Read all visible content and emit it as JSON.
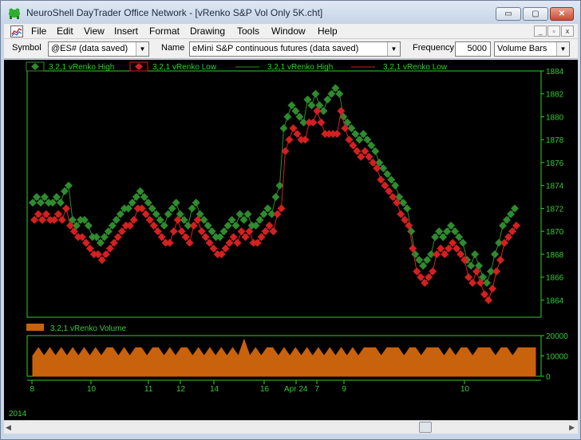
{
  "window": {
    "title": "NeuroShell DayTrader Office Network - [vRenko S&P Vol Only 5K.cht]",
    "controls": {
      "minimize": "▭",
      "maximize": "▢",
      "close": "✕"
    }
  },
  "menubar": {
    "items": [
      "File",
      "Edit",
      "View",
      "Insert",
      "Format",
      "Drawing",
      "Tools",
      "Window",
      "Help"
    ],
    "mdi": {
      "minimize": "_",
      "restore": "▫",
      "close": "x"
    }
  },
  "toolbar": {
    "symbol_label": "Symbol",
    "symbol_value": "@ES# (data saved)",
    "name_label": "Name",
    "name_value": "eMini S&P continuous futures (data saved)",
    "frequency_label": "Frequency",
    "frequency_value": "5000",
    "bars_value": "Volume Bars"
  },
  "colors": {
    "high": "#2e8b2e",
    "low": "#d42020",
    "axis": "#33cc33",
    "volume": "#c8620c",
    "background": "#000000"
  },
  "legend": {
    "price": [
      "3,2,1 vRenko High",
      "3,2,1 vRenko Low",
      "3,2,1 vRenko High",
      "3,2,1 vRenko Low"
    ],
    "volume": "3,2,1 vRenko Volume"
  },
  "chart_data": [
    {
      "type": "scatter",
      "series": [
        {
          "name": "3,2,1 vRenko High",
          "values": [
            1872.5,
            1873,
            1872.5,
            1873,
            1872.5,
            1872.5,
            1873,
            1872.5,
            1873.5,
            1874,
            1871,
            1870.5,
            1871,
            1871,
            1870.5,
            1869.5,
            1869.5,
            1869,
            1869.5,
            1870,
            1870.5,
            1871,
            1871.5,
            1872,
            1872,
            1872.5,
            1873,
            1873.5,
            1873,
            1872.5,
            1872,
            1871.5,
            1871,
            1870.5,
            1871.5,
            1872,
            1872.5,
            1871.5,
            1871,
            1870.5,
            1872,
            1872.5,
            1871.5,
            1871,
            1870.5,
            1870,
            1869.5,
            1869.5,
            1870,
            1870.5,
            1871,
            1870.5,
            1871.5,
            1871,
            1871.5,
            1870.5,
            1870.5,
            1871,
            1871.5,
            1872,
            1871.5,
            1873,
            1874,
            1879,
            1880,
            1881,
            1880.5,
            1880,
            1879.5,
            1881.5,
            1881,
            1882,
            1881,
            1880.5,
            1881.5,
            1882,
            1882.5,
            1882,
            1880,
            1879.5,
            1879,
            1878.5,
            1878,
            1878.5,
            1878,
            1877.5,
            1877,
            1876,
            1875.5,
            1875,
            1874.5,
            1874,
            1873,
            1872.5,
            1872,
            1870,
            1868,
            1867.5,
            1867,
            1867.5,
            1868,
            1869.5,
            1870,
            1869.5,
            1870,
            1870.5,
            1870,
            1869.5,
            1869,
            1867.5,
            1867,
            1868,
            1867,
            1866,
            1865.5,
            1866.5,
            1868,
            1869,
            1870.5,
            1871,
            1871.5,
            1872
          ]
        },
        {
          "name": "3,2,1 vRenko Low",
          "values": [
            1871,
            1871.5,
            1871,
            1871.5,
            1871,
            1871,
            1871.5,
            1871,
            1872,
            1870.5,
            1870,
            1869.5,
            1869.5,
            1869,
            1868.5,
            1868,
            1868,
            1867.5,
            1868,
            1868.5,
            1869,
            1869.5,
            1870,
            1870.5,
            1870.5,
            1871,
            1872,
            1872,
            1871.5,
            1871,
            1870.5,
            1870,
            1869.5,
            1869,
            1869,
            1870,
            1871,
            1870,
            1869.5,
            1869,
            1870.5,
            1871,
            1870,
            1869.5,
            1869,
            1868.5,
            1868,
            1868,
            1868.5,
            1869,
            1869.5,
            1869,
            1870,
            1869.5,
            1870,
            1869,
            1869,
            1869.5,
            1870,
            1870.5,
            1870,
            1871.5,
            1872,
            1877,
            1878,
            1879,
            1878.5,
            1878,
            1878,
            1879.5,
            1879.5,
            1880.5,
            1879.5,
            1878.5,
            1878.5,
            1878.5,
            1878.5,
            1880.5,
            1879,
            1878,
            1877.5,
            1877,
            1876.5,
            1877,
            1876.5,
            1876,
            1875.5,
            1874.5,
            1874,
            1873.5,
            1873,
            1872.5,
            1871.5,
            1871,
            1870.5,
            1868.5,
            1866.5,
            1866,
            1865.5,
            1866,
            1866.5,
            1868,
            1868.5,
            1868,
            1868.5,
            1869,
            1868.5,
            1868,
            1867.5,
            1866,
            1865.5,
            1866.5,
            1865.5,
            1864.5,
            1864,
            1865,
            1866.5,
            1867.5,
            1869,
            1869.5,
            1870,
            1870.5
          ]
        }
      ],
      "ylim": [
        1862.5,
        1884
      ],
      "yticks": [
        1864,
        1866,
        1868,
        1870,
        1872,
        1874,
        1876,
        1878,
        1880,
        1882,
        1884
      ]
    },
    {
      "type": "area",
      "series": [
        {
          "name": "3,2,1 vRenko Volume",
          "values": [
            10000,
            14000,
            10000,
            14000,
            10000,
            14000,
            10000,
            14000,
            10000,
            14000,
            10000,
            14000,
            10000,
            14000,
            14000,
            10000,
            14000,
            10000,
            14000,
            14000,
            10000,
            14000,
            14000,
            10000,
            14000,
            10000,
            14000,
            14000,
            10000,
            14000,
            10000,
            14000,
            10000,
            14000,
            10000,
            14000,
            10000,
            18000,
            10000,
            14000,
            10000,
            14000,
            14000,
            10000,
            14000,
            10000,
            14000,
            10000,
            14000,
            10000,
            14000,
            10000,
            14000,
            10000,
            14000,
            10000,
            14000,
            10000,
            14000,
            14000,
            14000,
            10000,
            14000,
            14000,
            14000,
            10000,
            14000,
            14000,
            10000,
            14000,
            14000,
            14000,
            10000,
            14000,
            10000,
            14000,
            14000,
            10000,
            14000,
            14000,
            14000,
            10000,
            14000,
            14000,
            10000,
            14000,
            14000,
            14000,
            14000
          ]
        }
      ],
      "ylim": [
        0,
        20000
      ],
      "yticks": [
        0,
        10000,
        20000
      ]
    }
  ],
  "x_axis": {
    "ticks": [
      "8",
      "10",
      "11",
      "12",
      "14",
      "16",
      "Apr 24",
      "7",
      "9",
      "10"
    ],
    "year": "2014"
  }
}
